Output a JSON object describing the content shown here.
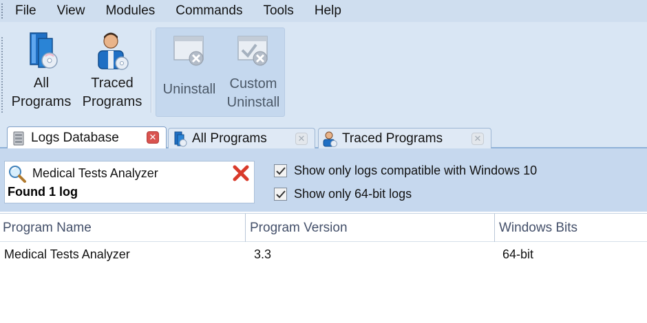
{
  "menu": {
    "items": [
      "File",
      "View",
      "Modules",
      "Commands",
      "Tools",
      "Help"
    ]
  },
  "toolbar": {
    "all_programs": {
      "line1": "All",
      "line2": "Programs",
      "icon": "all-programs-icon"
    },
    "traced_programs": {
      "line1": "Traced",
      "line2": "Programs",
      "icon": "traced-programs-icon"
    },
    "uninstall": {
      "line1": "Uninstall",
      "icon": "uninstall-icon"
    },
    "custom_uninstall": {
      "line1": "Custom",
      "line2": "Uninstall",
      "icon": "custom-uninstall-icon"
    }
  },
  "tabs": [
    {
      "label": "Logs Database",
      "icon": "database-icon",
      "active": true
    },
    {
      "label": "All Programs",
      "icon": "all-programs-icon",
      "active": false
    },
    {
      "label": "Traced Programs",
      "icon": "traced-programs-icon",
      "active": false
    }
  ],
  "search": {
    "value": "Medical Tests Analyzer",
    "result_text": "Found 1 log"
  },
  "filters": {
    "windows10": {
      "label": "Show only logs compatible with Windows 10",
      "checked": true
    },
    "bits64": {
      "label": "Show only 64-bit logs",
      "checked": true
    }
  },
  "table": {
    "columns": [
      "Program Name",
      "Program Version",
      "Windows Bits"
    ],
    "rows": [
      [
        "Medical Tests Analyzer",
        "3.3",
        "64-bit"
      ]
    ]
  },
  "colors": {
    "menubar_bg": "#cfdeef",
    "ribbon_bg": "#d9e6f4",
    "filter_bg": "#c6d8ee",
    "close_red": "#d9534f"
  }
}
